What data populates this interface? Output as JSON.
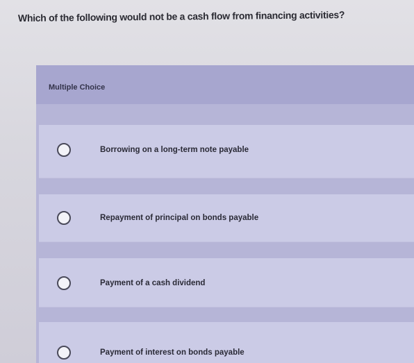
{
  "question": {
    "text": "Which of the following would not be a cash flow from financing activities?"
  },
  "card": {
    "header_label": "Multiple Choice"
  },
  "options": [
    {
      "label": "Borrowing on a long-term note payable"
    },
    {
      "label": "Repayment of principal on bonds payable"
    },
    {
      "label": "Payment of a cash dividend"
    },
    {
      "label": "Payment of interest on bonds payable"
    }
  ],
  "colors": {
    "background": "#d9d8de",
    "card": "#b6b5d7",
    "header": "#a7a6cf",
    "option": "#cbcbe6",
    "text": "#2a2a36"
  },
  "icons": {
    "radio": "radio-unselected-icon"
  }
}
